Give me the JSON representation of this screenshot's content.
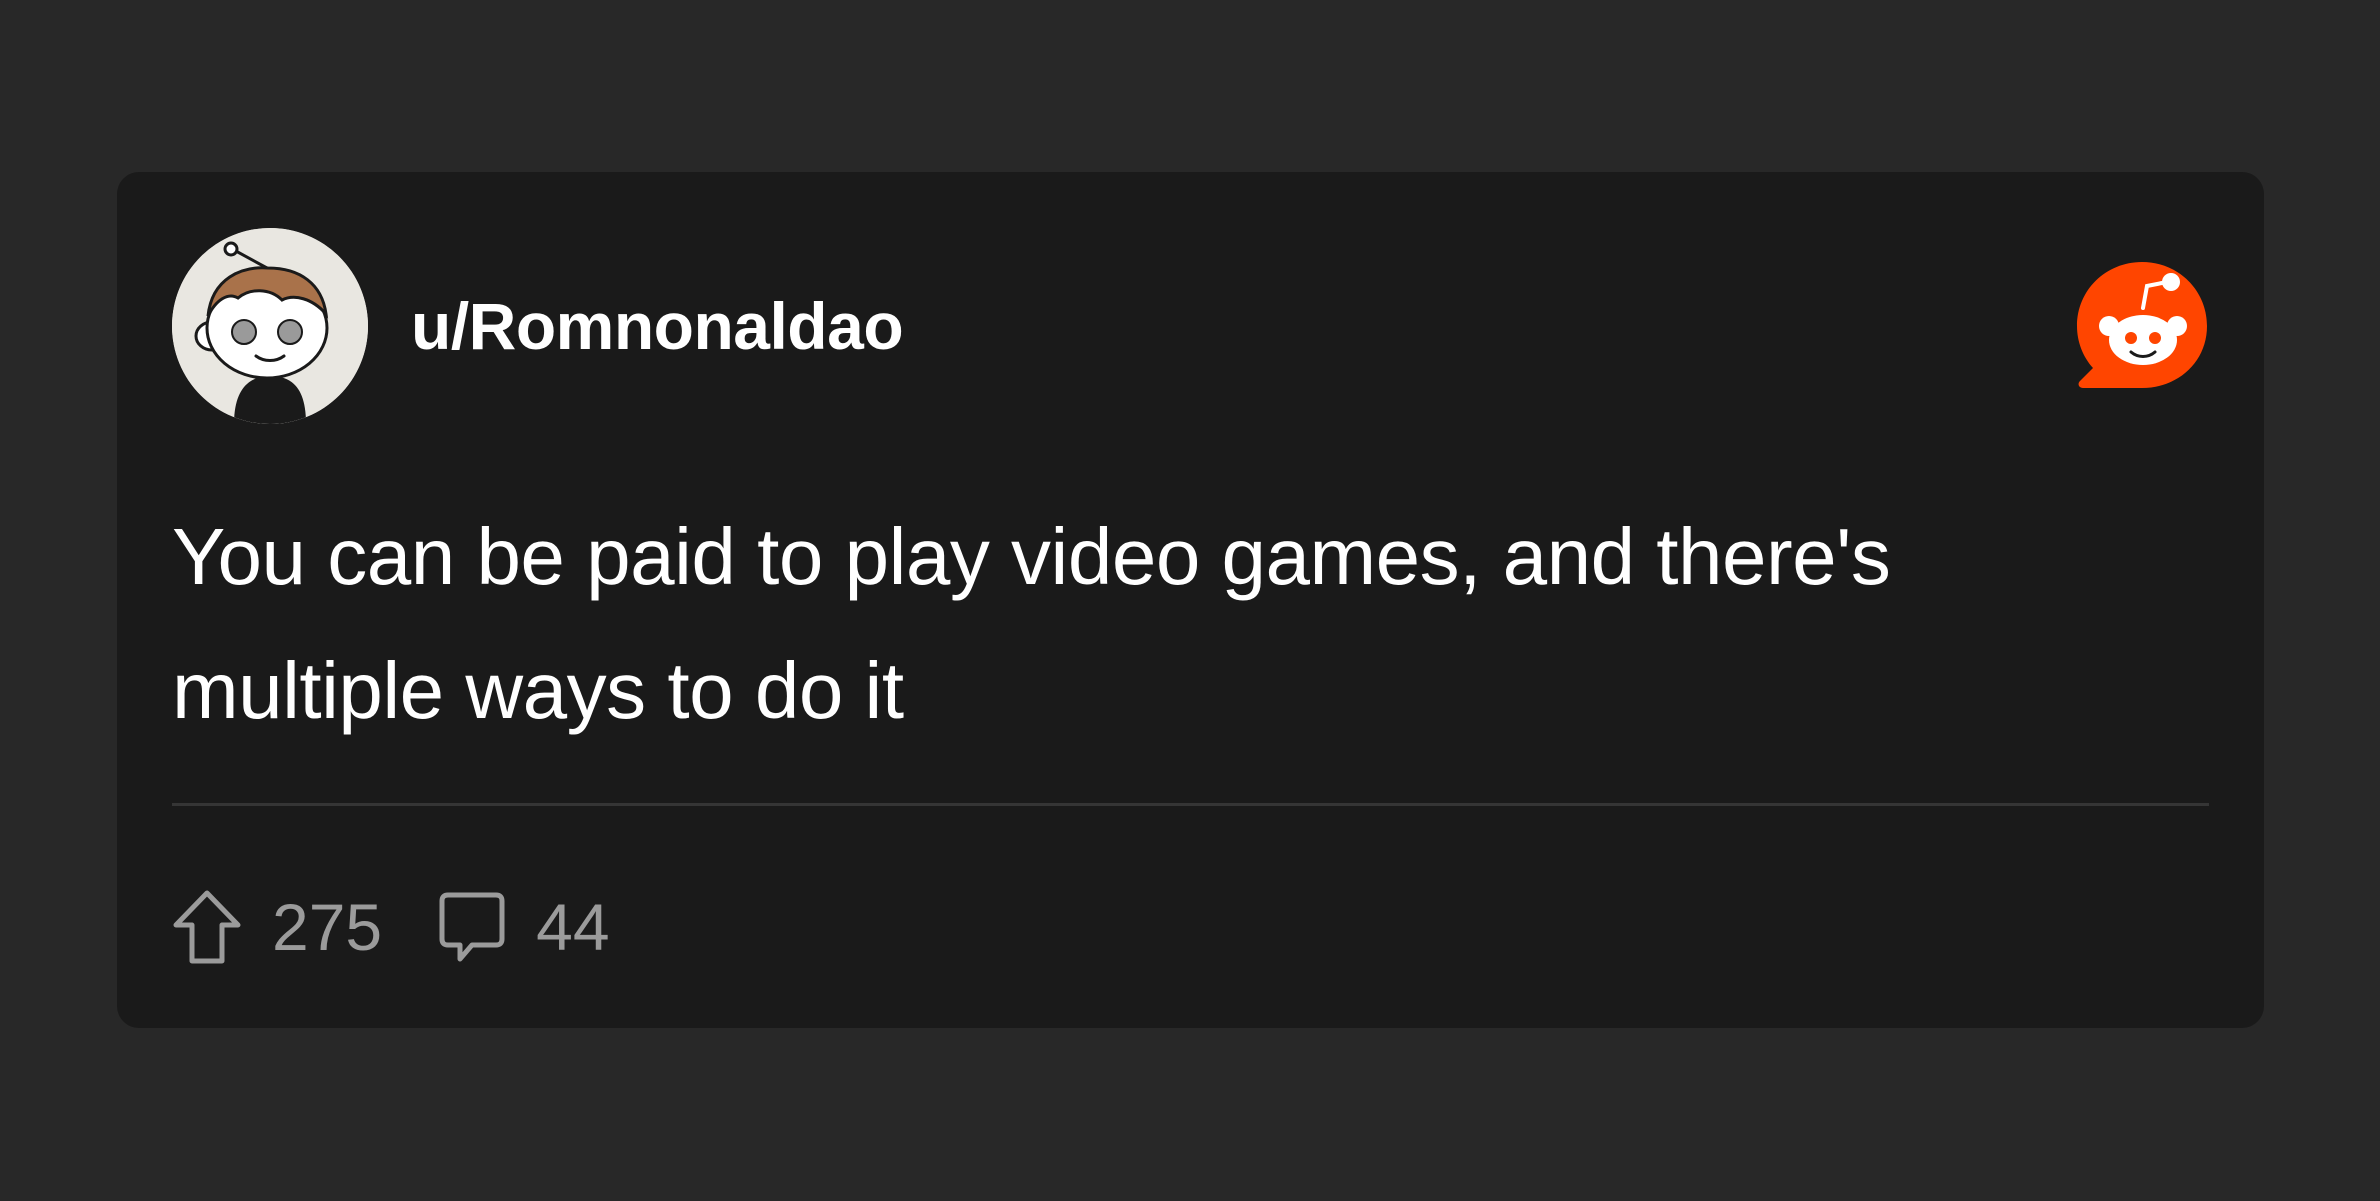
{
  "post": {
    "username": "u/Romnonaldao",
    "text": "You can be paid to play video games, and there's multiple ways to do it",
    "upvotes": "275",
    "comments": "44"
  },
  "icons": {
    "avatar": "reddit-snoo-avatar",
    "brand": "reddit-logo-icon",
    "upvote": "arrow-up-outline-icon",
    "comment": "speech-bubble-icon"
  },
  "colors": {
    "background": "#282828",
    "card": "#1a1a1a",
    "text": "#ffffff",
    "muted": "#9b9b9b",
    "brand": "#ff4500"
  }
}
